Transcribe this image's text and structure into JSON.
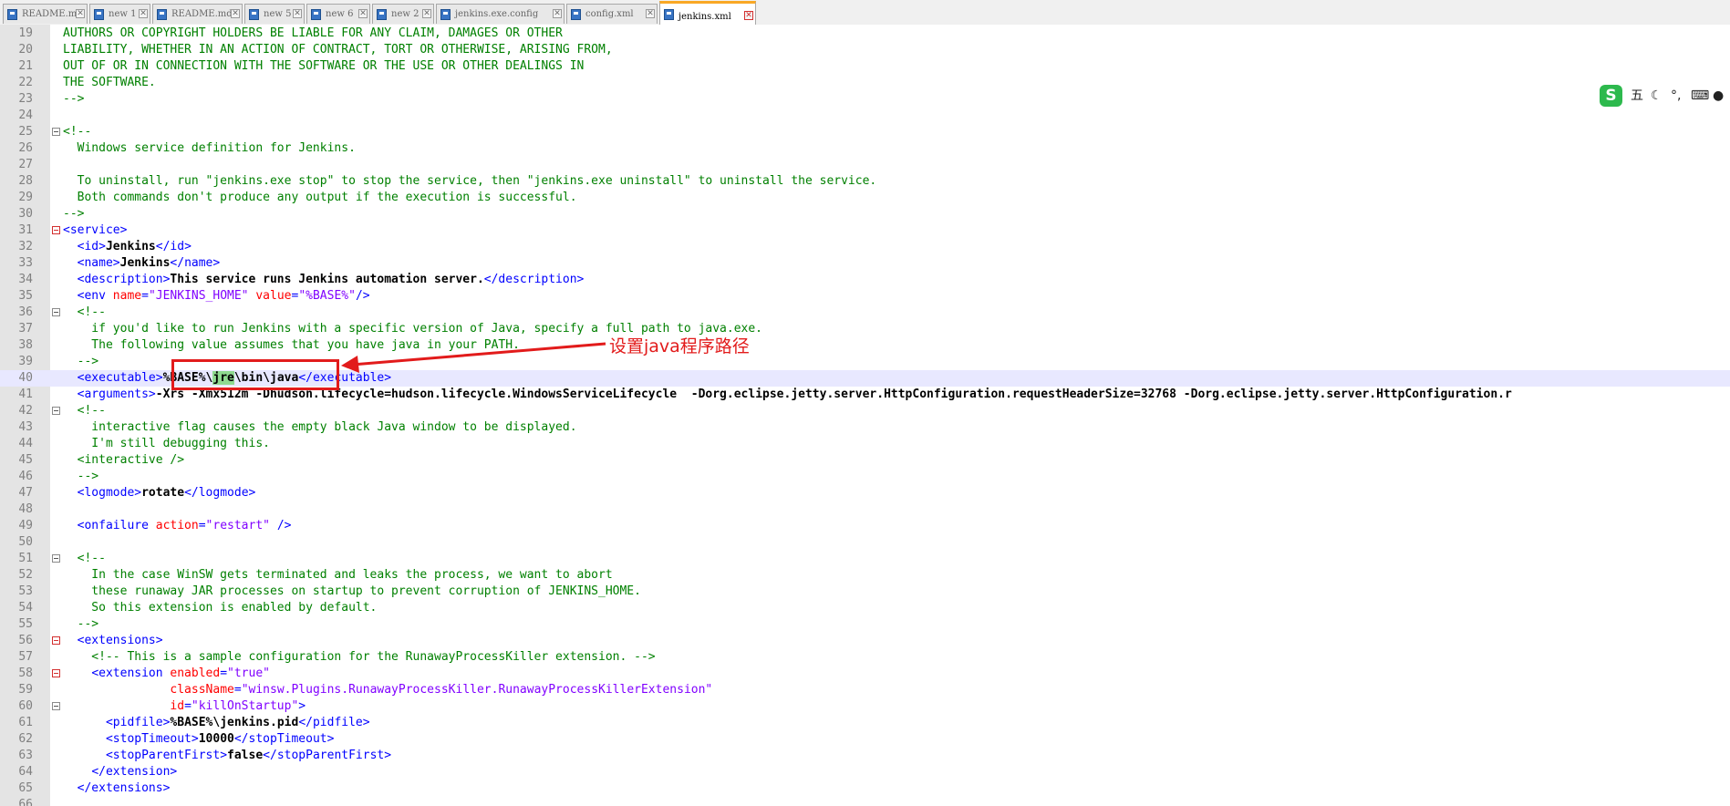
{
  "tabs": [
    {
      "label": "README.md",
      "active": false
    },
    {
      "label": "new 1",
      "active": false
    },
    {
      "label": "README.md",
      "active": false
    },
    {
      "label": "new 5",
      "active": false
    },
    {
      "label": "new 6",
      "active": false
    },
    {
      "label": "new 2",
      "active": false
    },
    {
      "label": "jenkins.exe.config",
      "active": false
    },
    {
      "label": "config.xml",
      "active": false
    },
    {
      "label": "jenkins.xml",
      "active": true
    }
  ],
  "tab_close_glyph": "✕",
  "editor": {
    "current_line": 40,
    "lines": [
      {
        "n": 19,
        "parts": [
          [
            "cm",
            "AUTHORS OR COPYRIGHT HOLDERS BE LIABLE FOR ANY CLAIM, DAMAGES OR OTHER"
          ]
        ]
      },
      {
        "n": 20,
        "parts": [
          [
            "cm",
            "LIABILITY, WHETHER IN AN ACTION OF CONTRACT, TORT OR OTHERWISE, ARISING FROM,"
          ]
        ]
      },
      {
        "n": 21,
        "parts": [
          [
            "cm",
            "OUT OF OR IN CONNECTION WITH THE SOFTWARE OR THE USE OR OTHER DEALINGS IN"
          ]
        ]
      },
      {
        "n": 22,
        "parts": [
          [
            "cm",
            "THE SOFTWARE."
          ]
        ]
      },
      {
        "n": 23,
        "parts": [
          [
            "cm",
            "-->"
          ]
        ]
      },
      {
        "n": 24,
        "parts": []
      },
      {
        "n": 25,
        "fold": "gray",
        "parts": [
          [
            "cm",
            "<!--"
          ]
        ]
      },
      {
        "n": 26,
        "parts": [
          [
            "cm",
            "  Windows service definition for Jenkins."
          ]
        ]
      },
      {
        "n": 27,
        "parts": []
      },
      {
        "n": 28,
        "parts": [
          [
            "cm",
            "  To uninstall, run \"jenkins.exe stop\" to stop the service, then \"jenkins.exe uninstall\" to uninstall the service."
          ]
        ]
      },
      {
        "n": 29,
        "parts": [
          [
            "cm",
            "  Both commands don't produce any output if the execution is successful."
          ]
        ]
      },
      {
        "n": 30,
        "parts": [
          [
            "cm",
            "-->"
          ]
        ]
      },
      {
        "n": 31,
        "fold": "red",
        "parts": [
          [
            "tg",
            "<service>"
          ]
        ]
      },
      {
        "n": 32,
        "parts": [
          [
            "",
            "  "
          ],
          [
            "tg",
            "<id>"
          ],
          [
            "tx",
            "Jenkins"
          ],
          [
            "tg",
            "</id>"
          ]
        ]
      },
      {
        "n": 33,
        "parts": [
          [
            "",
            "  "
          ],
          [
            "tg",
            "<name>"
          ],
          [
            "tx",
            "Jenkins"
          ],
          [
            "tg",
            "</name>"
          ]
        ]
      },
      {
        "n": 34,
        "parts": [
          [
            "",
            "  "
          ],
          [
            "tg",
            "<description>"
          ],
          [
            "tx",
            "This service runs Jenkins automation server."
          ],
          [
            "tg",
            "</description>"
          ]
        ]
      },
      {
        "n": 35,
        "parts": [
          [
            "",
            "  "
          ],
          [
            "tg",
            "<env "
          ],
          [
            "at",
            "name"
          ],
          [
            "tg",
            "="
          ],
          [
            "sv",
            "\"JENKINS_HOME\""
          ],
          [
            "tg",
            " "
          ],
          [
            "at",
            "value"
          ],
          [
            "tg",
            "="
          ],
          [
            "sv",
            "\"%BASE%\""
          ],
          [
            "tg",
            "/>"
          ]
        ]
      },
      {
        "n": 36,
        "fold": "gray",
        "parts": [
          [
            "cm",
            "  <!--"
          ]
        ]
      },
      {
        "n": 37,
        "parts": [
          [
            "cm",
            "    if you'd like to run Jenkins with a specific version of Java, specify a full path to java.exe."
          ]
        ]
      },
      {
        "n": 38,
        "parts": [
          [
            "cm",
            "    The following value assumes that you have java in your PATH."
          ]
        ]
      },
      {
        "n": 39,
        "parts": [
          [
            "cm",
            "  -->"
          ]
        ]
      },
      {
        "n": 40,
        "parts": [
          [
            "",
            "  "
          ],
          [
            "tg",
            "<executable>"
          ],
          [
            "tx",
            "%BASE%\\"
          ],
          [
            "hl",
            "jre"
          ],
          [
            "tx",
            "\\bin\\java"
          ],
          [
            "tg",
            "</executable>"
          ]
        ]
      },
      {
        "n": 41,
        "parts": [
          [
            "",
            "  "
          ],
          [
            "tg",
            "<arguments>"
          ],
          [
            "tx",
            "-Xrs -Xmx512m -Dhudson.lifecycle=hudson.lifecycle.WindowsServiceLifecycle  -Dorg.eclipse.jetty.server.HttpConfiguration.requestHeaderSize=32768 -Dorg.eclipse.jetty.server.HttpConfiguration.r"
          ]
        ]
      },
      {
        "n": 42,
        "fold": "gray",
        "parts": [
          [
            "cm",
            "  <!--"
          ]
        ]
      },
      {
        "n": 43,
        "parts": [
          [
            "cm",
            "    interactive flag causes the empty black Java window to be displayed."
          ]
        ]
      },
      {
        "n": 44,
        "parts": [
          [
            "cm",
            "    I'm still debugging this."
          ]
        ]
      },
      {
        "n": 45,
        "parts": [
          [
            "cm",
            "  <interactive />"
          ]
        ]
      },
      {
        "n": 46,
        "parts": [
          [
            "cm",
            "  -->"
          ]
        ]
      },
      {
        "n": 47,
        "parts": [
          [
            "",
            "  "
          ],
          [
            "tg",
            "<logmode>"
          ],
          [
            "tx",
            "rotate"
          ],
          [
            "tg",
            "</logmode>"
          ]
        ]
      },
      {
        "n": 48,
        "parts": []
      },
      {
        "n": 49,
        "parts": [
          [
            "",
            "  "
          ],
          [
            "tg",
            "<onfailure "
          ],
          [
            "at",
            "action"
          ],
          [
            "tg",
            "="
          ],
          [
            "sv",
            "\"restart\""
          ],
          [
            "tg",
            " />"
          ]
        ]
      },
      {
        "n": 50,
        "parts": []
      },
      {
        "n": 51,
        "fold": "gray",
        "parts": [
          [
            "cm",
            "  <!--"
          ]
        ]
      },
      {
        "n": 52,
        "parts": [
          [
            "cm",
            "    In the case WinSW gets terminated and leaks the process, we want to abort"
          ]
        ]
      },
      {
        "n": 53,
        "parts": [
          [
            "cm",
            "    these runaway JAR processes on startup to prevent corruption of JENKINS_HOME."
          ]
        ]
      },
      {
        "n": 54,
        "parts": [
          [
            "cm",
            "    So this extension is enabled by default."
          ]
        ]
      },
      {
        "n": 55,
        "parts": [
          [
            "cm",
            "  -->"
          ]
        ]
      },
      {
        "n": 56,
        "fold": "red",
        "parts": [
          [
            "",
            "  "
          ],
          [
            "tg",
            "<extensions>"
          ]
        ]
      },
      {
        "n": 57,
        "parts": [
          [
            "cm",
            "    <!-- This is a sample configuration for the RunawayProcessKiller extension. -->"
          ]
        ]
      },
      {
        "n": 58,
        "fold": "red",
        "parts": [
          [
            "",
            "    "
          ],
          [
            "tg",
            "<extension "
          ],
          [
            "at",
            "enabled"
          ],
          [
            "tg",
            "="
          ],
          [
            "sv",
            "\"true\""
          ]
        ]
      },
      {
        "n": 59,
        "parts": [
          [
            "",
            "               "
          ],
          [
            "at",
            "className"
          ],
          [
            "tg",
            "="
          ],
          [
            "sv",
            "\"winsw.Plugins.RunawayProcessKiller.RunawayProcessKillerExtension\""
          ]
        ]
      },
      {
        "n": 60,
        "fold": "gray",
        "parts": [
          [
            "",
            "               "
          ],
          [
            "at",
            "id"
          ],
          [
            "tg",
            "="
          ],
          [
            "sv",
            "\"killOnStartup\""
          ],
          [
            "tg",
            ">"
          ]
        ]
      },
      {
        "n": 61,
        "parts": [
          [
            "",
            "      "
          ],
          [
            "tg",
            "<pidfile>"
          ],
          [
            "tx",
            "%BASE%\\jenkins.pid"
          ],
          [
            "tg",
            "</pidfile>"
          ]
        ]
      },
      {
        "n": 62,
        "parts": [
          [
            "",
            "      "
          ],
          [
            "tg",
            "<stopTimeout>"
          ],
          [
            "tx",
            "10000"
          ],
          [
            "tg",
            "</stopTimeout>"
          ]
        ]
      },
      {
        "n": 63,
        "parts": [
          [
            "",
            "      "
          ],
          [
            "tg",
            "<stopParentFirst>"
          ],
          [
            "tx",
            "false"
          ],
          [
            "tg",
            "</stopParentFirst>"
          ]
        ]
      },
      {
        "n": 64,
        "parts": [
          [
            "",
            "    "
          ],
          [
            "tg",
            "</extension>"
          ]
        ]
      },
      {
        "n": 65,
        "parts": [
          [
            "",
            "  "
          ],
          [
            "tg",
            "</extensions>"
          ]
        ]
      },
      {
        "n": 66,
        "parts": []
      }
    ]
  },
  "annotation": {
    "label": "设置java程序路径",
    "color": "#e21b1b"
  },
  "ime_toolbar": {
    "logo": "S",
    "mode": "五",
    "moon": "☾",
    "punct": "°,",
    "keyboard": "⌨",
    "user": "●"
  },
  "colors": {
    "comment": "#008000",
    "tag": "#0000ff",
    "attribute": "#ff0000",
    "string": "#8000ff",
    "current_line": "#e8e8ff",
    "active_tab_accent": "#f9a825"
  }
}
